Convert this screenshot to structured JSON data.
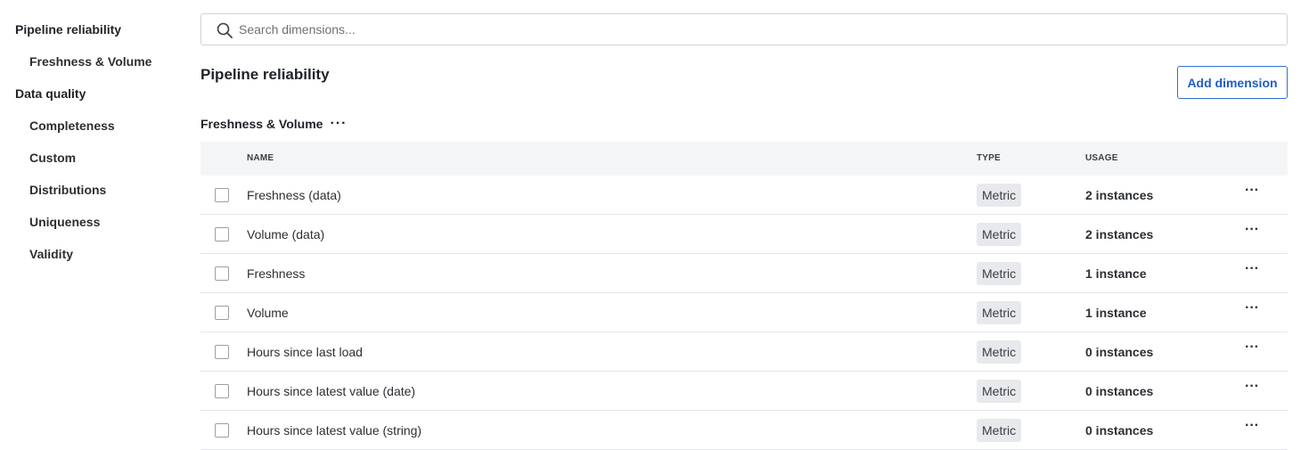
{
  "sidebar": {
    "items": [
      {
        "label": "Pipeline reliability"
      },
      {
        "label": "Freshness & Volume"
      },
      {
        "label": "Data quality"
      },
      {
        "label": "Completeness"
      },
      {
        "label": "Custom"
      },
      {
        "label": "Distributions"
      },
      {
        "label": "Uniqueness"
      },
      {
        "label": "Validity"
      }
    ]
  },
  "search": {
    "placeholder": "Search dimensions...",
    "value": "",
    "icon": "search-icon"
  },
  "section": {
    "title": "Pipeline reliability",
    "add_button": "Add dimension"
  },
  "group": {
    "label": "Freshness & Volume",
    "menu": "···"
  },
  "table": {
    "headers": {
      "name": "NAME",
      "type": "TYPE",
      "usage": "USAGE"
    },
    "rows": [
      {
        "name": "Freshness (data)",
        "type": "Metric",
        "usage": "2 instances",
        "menu": "···"
      },
      {
        "name": "Volume (data)",
        "type": "Metric",
        "usage": "2 instances",
        "menu": "···"
      },
      {
        "name": "Freshness",
        "type": "Metric",
        "usage": "1 instance",
        "menu": "···"
      },
      {
        "name": "Volume",
        "type": "Metric",
        "usage": "1 instance",
        "menu": "···"
      },
      {
        "name": "Hours since last load",
        "type": "Metric",
        "usage": "0 instances",
        "menu": "···"
      },
      {
        "name": "Hours since latest value (date)",
        "type": "Metric",
        "usage": "0 instances",
        "menu": "···"
      },
      {
        "name": "Hours since latest value (string)",
        "type": "Metric",
        "usage": "0 instances",
        "menu": "···"
      }
    ]
  },
  "colors": {
    "accent": "#1c5dc9",
    "header_bg": "#f4f5f7",
    "badge_bg": "#e7e9ec"
  }
}
